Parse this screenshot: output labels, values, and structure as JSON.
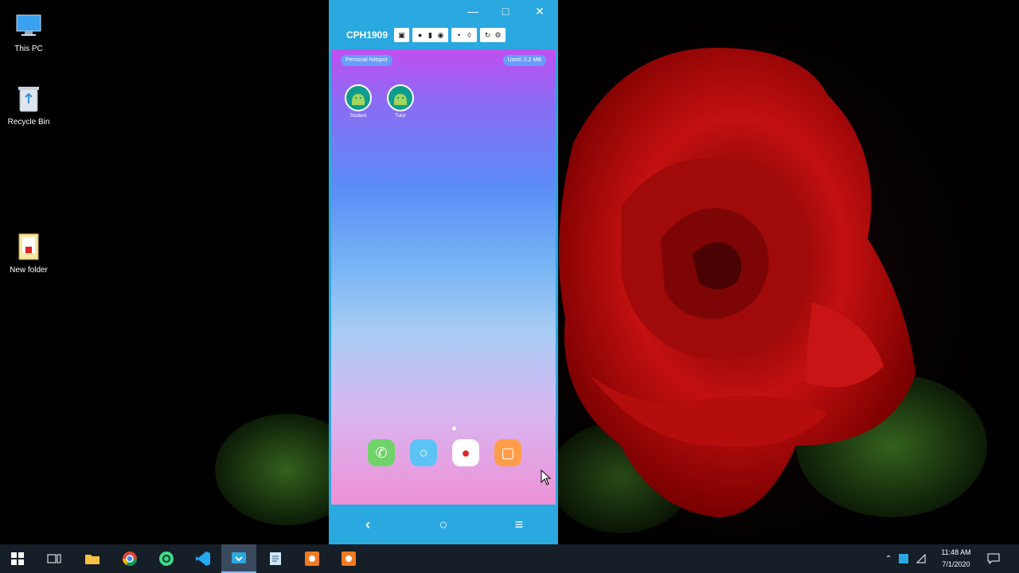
{
  "desktop": {
    "icons": [
      {
        "label": "This PC",
        "icon": "monitor-icon"
      },
      {
        "label": "Recycle Bin",
        "icon": "recycle-bin-icon"
      },
      {
        "label": "New folder",
        "icon": "folder-icon"
      }
    ]
  },
  "mirror_window": {
    "device_name": "CPH1909",
    "window_controls": [
      "minimize",
      "maximize",
      "close"
    ],
    "toolbar_icons": [
      "screenshot-icon",
      "record-icon",
      "video-icon",
      "camera-icon",
      "dot-icon",
      "volume-icon",
      "rotate-icon",
      "settings-icon"
    ]
  },
  "phone": {
    "status_left": "Personal hotspot",
    "status_right": "Used: 2.2 MB",
    "apps": [
      {
        "label": "Student",
        "icon": "android-icon"
      },
      {
        "label": "Tutor",
        "icon": "android-icon"
      }
    ],
    "dock": [
      {
        "name": "phone-icon",
        "color": "#6fd36a"
      },
      {
        "name": "messages-icon",
        "color": "#5cc4f5"
      },
      {
        "name": "camera-icon",
        "color": "#ffffff"
      },
      {
        "name": "gallery-icon",
        "color": "#ff9d4a"
      }
    ],
    "nav": {
      "back": "‹",
      "home": "○",
      "menu": "≡"
    }
  },
  "taskbar": {
    "apps": [
      "start-icon",
      "task-view-icon",
      "file-explorer-icon",
      "chrome-icon",
      "android-studio-icon",
      "vscode-icon",
      "mirror-app-icon",
      "notepad-icon",
      "app-icon",
      "app-icon"
    ],
    "clock_time": "11:48 AM",
    "clock_date": "7/1/2020"
  }
}
